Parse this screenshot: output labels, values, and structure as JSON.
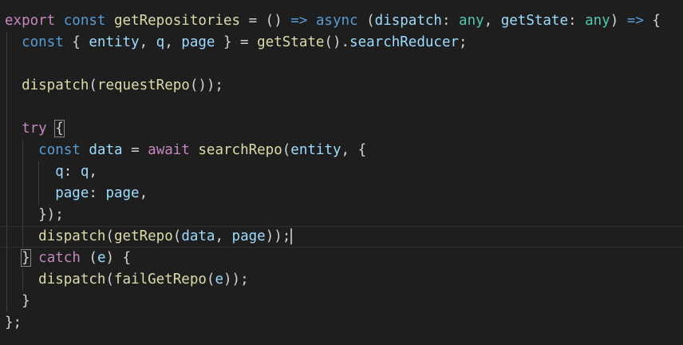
{
  "editor": {
    "colors": {
      "background": "#1e1e1e",
      "keyword": "#569cd6",
      "control": "#c586c0",
      "function": "#dcdcaa",
      "variable": "#9cdcfe",
      "type": "#4ec9b0",
      "default": "#d4d4d4"
    },
    "lines": [
      {
        "tokens": [
          {
            "t": "export",
            "c": "ctrl"
          },
          {
            "t": " ",
            "c": "pun"
          },
          {
            "t": "const",
            "c": "kw"
          },
          {
            "t": " ",
            "c": "pun"
          },
          {
            "t": "getRepositories",
            "c": "fn"
          },
          {
            "t": " = () ",
            "c": "pun"
          },
          {
            "t": "=>",
            "c": "kw"
          },
          {
            "t": " ",
            "c": "pun"
          },
          {
            "t": "async",
            "c": "kw"
          },
          {
            "t": " (",
            "c": "pun"
          },
          {
            "t": "dispatch",
            "c": "var"
          },
          {
            "t": ": ",
            "c": "pun"
          },
          {
            "t": "any",
            "c": "type"
          },
          {
            "t": ", ",
            "c": "pun"
          },
          {
            "t": "getState",
            "c": "var"
          },
          {
            "t": ": ",
            "c": "pun"
          },
          {
            "t": "any",
            "c": "type"
          },
          {
            "t": ") ",
            "c": "pun"
          },
          {
            "t": "=>",
            "c": "kw"
          },
          {
            "t": " {",
            "c": "pun"
          }
        ]
      },
      {
        "tokens": [
          {
            "t": "  ",
            "c": "pun"
          },
          {
            "t": "const",
            "c": "kw"
          },
          {
            "t": " { ",
            "c": "pun"
          },
          {
            "t": "entity",
            "c": "var"
          },
          {
            "t": ", ",
            "c": "pun"
          },
          {
            "t": "q",
            "c": "var"
          },
          {
            "t": ", ",
            "c": "pun"
          },
          {
            "t": "page",
            "c": "var"
          },
          {
            "t": " } = ",
            "c": "pun"
          },
          {
            "t": "getState",
            "c": "fn"
          },
          {
            "t": "().",
            "c": "pun"
          },
          {
            "t": "searchReducer",
            "c": "var"
          },
          {
            "t": ";",
            "c": "pun"
          }
        ]
      },
      {
        "tokens": []
      },
      {
        "tokens": [
          {
            "t": "  ",
            "c": "pun"
          },
          {
            "t": "dispatch",
            "c": "fn"
          },
          {
            "t": "(",
            "c": "pun"
          },
          {
            "t": "requestRepo",
            "c": "fn"
          },
          {
            "t": "());",
            "c": "pun"
          }
        ]
      },
      {
        "tokens": []
      },
      {
        "tokens": [
          {
            "t": "  ",
            "c": "pun"
          },
          {
            "t": "try",
            "c": "ctrl"
          },
          {
            "t": " ",
            "c": "pun"
          },
          {
            "t": "{",
            "c": "pun",
            "box": true
          }
        ]
      },
      {
        "tokens": [
          {
            "t": "    ",
            "c": "pun"
          },
          {
            "t": "const",
            "c": "kw"
          },
          {
            "t": " ",
            "c": "pun"
          },
          {
            "t": "data",
            "c": "var"
          },
          {
            "t": " = ",
            "c": "pun"
          },
          {
            "t": "await",
            "c": "ctrl"
          },
          {
            "t": " ",
            "c": "pun"
          },
          {
            "t": "searchRepo",
            "c": "fn"
          },
          {
            "t": "(",
            "c": "pun"
          },
          {
            "t": "entity",
            "c": "var"
          },
          {
            "t": ", {",
            "c": "pun"
          }
        ]
      },
      {
        "tokens": [
          {
            "t": "      ",
            "c": "pun"
          },
          {
            "t": "q",
            "c": "var"
          },
          {
            "t": ": ",
            "c": "pun"
          },
          {
            "t": "q",
            "c": "var"
          },
          {
            "t": ",",
            "c": "pun"
          }
        ]
      },
      {
        "tokens": [
          {
            "t": "      ",
            "c": "pun"
          },
          {
            "t": "page",
            "c": "var"
          },
          {
            "t": ": ",
            "c": "pun"
          },
          {
            "t": "page",
            "c": "var"
          },
          {
            "t": ",",
            "c": "pun"
          }
        ]
      },
      {
        "tokens": [
          {
            "t": "    });",
            "c": "pun"
          }
        ]
      },
      {
        "active": true,
        "cursor": true,
        "tokens": [
          {
            "t": "    ",
            "c": "pun"
          },
          {
            "t": "dispatch",
            "c": "fn"
          },
          {
            "t": "(",
            "c": "pun"
          },
          {
            "t": "getRepo",
            "c": "fn"
          },
          {
            "t": "(",
            "c": "pun"
          },
          {
            "t": "data",
            "c": "var"
          },
          {
            "t": ", ",
            "c": "pun"
          },
          {
            "t": "page",
            "c": "var"
          },
          {
            "t": "));",
            "c": "pun"
          }
        ]
      },
      {
        "tokens": [
          {
            "t": "  ",
            "c": "pun"
          },
          {
            "t": "}",
            "c": "pun",
            "box": true
          },
          {
            "t": " ",
            "c": "pun"
          },
          {
            "t": "catch",
            "c": "ctrl"
          },
          {
            "t": " (",
            "c": "pun"
          },
          {
            "t": "e",
            "c": "var"
          },
          {
            "t": ") {",
            "c": "pun"
          }
        ]
      },
      {
        "tokens": [
          {
            "t": "    ",
            "c": "pun"
          },
          {
            "t": "dispatch",
            "c": "fn"
          },
          {
            "t": "(",
            "c": "pun"
          },
          {
            "t": "failGetRepo",
            "c": "fn"
          },
          {
            "t": "(",
            "c": "pun"
          },
          {
            "t": "e",
            "c": "var"
          },
          {
            "t": "));",
            "c": "pun"
          }
        ]
      },
      {
        "tokens": [
          {
            "t": "  }",
            "c": "pun"
          }
        ]
      },
      {
        "tokens": [
          {
            "t": "};",
            "c": "pun"
          }
        ]
      }
    ]
  }
}
